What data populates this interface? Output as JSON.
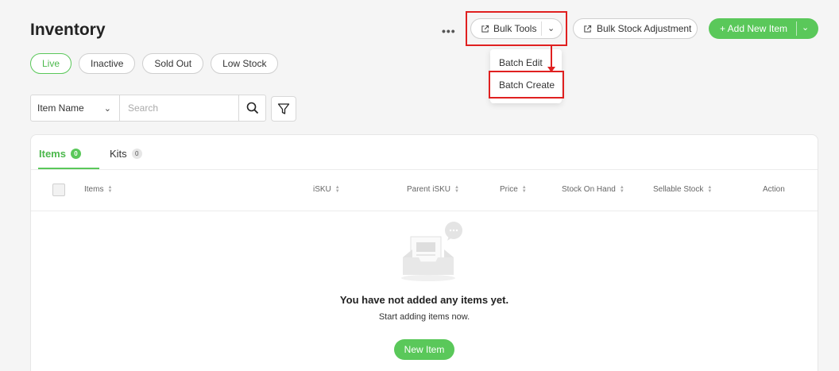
{
  "page": {
    "title": "Inventory"
  },
  "header": {
    "more_label": "•••",
    "bulk_tools_label": "Bulk Tools",
    "bulk_stock_label": "Bulk Stock Adjustment",
    "add_new_label": "+ Add New Item"
  },
  "bulk_menu": {
    "items": [
      "Batch Edit",
      "Batch Create"
    ]
  },
  "filters": [
    "Live",
    "Inactive",
    "Sold Out",
    "Low Stock"
  ],
  "search": {
    "field": "Item Name",
    "placeholder": "Search"
  },
  "tabs": [
    {
      "label": "Items",
      "count": "0"
    },
    {
      "label": "Kits",
      "count": "0"
    }
  ],
  "table": {
    "columns": [
      "Items",
      "iSKU",
      "Parent iSKU",
      "Price",
      "Stock On Hand",
      "Sellable Stock",
      "Action"
    ]
  },
  "empty_state": {
    "title": "You have not added any items yet.",
    "subtitle": "Start adding items now.",
    "button_label": "New Item"
  },
  "colors": {
    "accent": "#5ac85a",
    "highlight": "#e02020"
  }
}
